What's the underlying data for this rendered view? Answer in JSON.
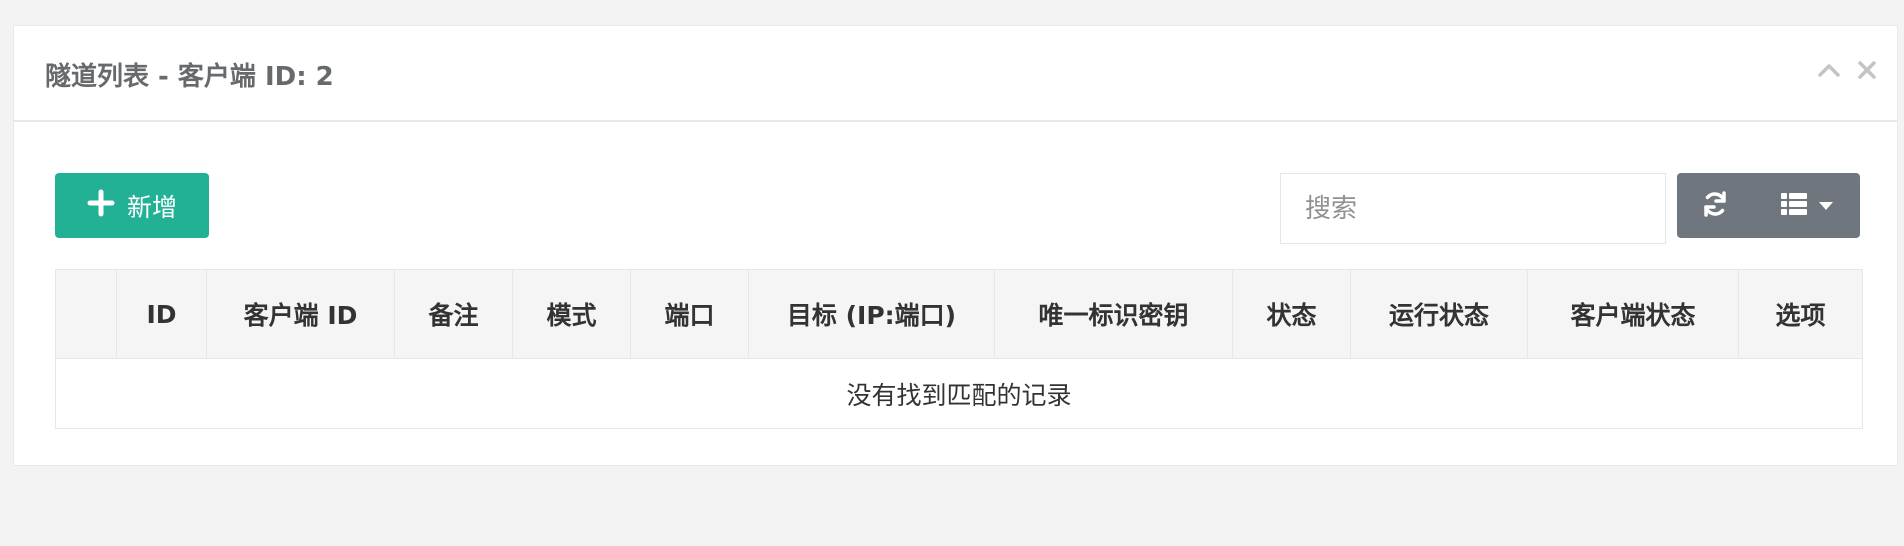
{
  "panel": {
    "title": "隧道列表 - 客户端 ID: 2",
    "tools": {
      "collapse_icon": "chevron-up-icon",
      "close_icon": "close-icon"
    }
  },
  "toolbar": {
    "add_label": "新增",
    "add_icon": "plus-icon",
    "search_placeholder": "搜索",
    "search_value": "",
    "refresh_icon": "refresh-icon",
    "columns_icon": "list-icon",
    "columns_dropdown_icon": "caret-down-icon"
  },
  "table": {
    "columns": [
      "",
      "ID",
      "客户端 ID",
      "备注",
      "模式",
      "端口",
      "目标 (IP:端口)",
      "唯一标识密钥",
      "状态",
      "运行状态",
      "客户端状态",
      "选项"
    ],
    "empty_message": "没有找到匹配的记录"
  },
  "colors": {
    "page_bg": "#f3f3f4",
    "primary": "#23b196",
    "secondary": "#6f767e"
  }
}
